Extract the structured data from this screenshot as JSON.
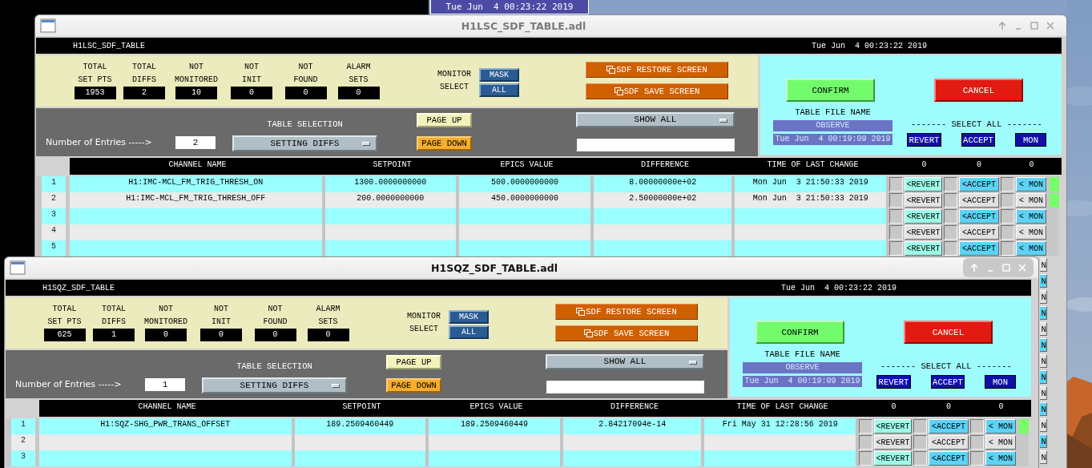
{
  "desktop": {
    "clock": "Tue Jun  4 00:23:22 2019"
  },
  "windows": [
    {
      "title": "H1LSC_SDF_TABLE.adl",
      "active": false,
      "screen_name": "H1LSC_SDF_TABLE",
      "time": "Tue Jun  4 00:23:22 2019",
      "stats": [
        {
          "label": [
            "TOTAL",
            "SET PTS"
          ],
          "value": "1953"
        },
        {
          "label": [
            "TOTAL",
            "DIFFS"
          ],
          "value": "2"
        },
        {
          "label": [
            "NOT",
            "MONITORED"
          ],
          "value": "10"
        },
        {
          "label": [
            "NOT",
            "INIT"
          ],
          "value": "0"
        },
        {
          "label": [
            "NOT",
            "FOUND"
          ],
          "value": "0"
        },
        {
          "label": [
            "ALARM",
            "SETS"
          ],
          "value": "0"
        }
      ],
      "monitor_select": {
        "label": [
          "MONITOR",
          "SELECT"
        ],
        "buttons": [
          "MASK",
          "ALL"
        ]
      },
      "screen_buttons": [
        "SDF RESTORE SCREEN",
        "SDF SAVE SCREEN"
      ],
      "entries": {
        "label": "Number of Entries ----->",
        "value": "2"
      },
      "table_selection": {
        "label": "TABLE SELECTION",
        "value": "SETTING DIFFS"
      },
      "page_buttons": [
        {
          "label": "PAGE UP",
          "kind": "up"
        },
        {
          "label": "PAGE DOWN",
          "kind": "down"
        }
      ],
      "filter": {
        "value": "SHOW ALL"
      },
      "confirm": "CONFIRM",
      "cancel": "CANCEL",
      "file": {
        "label": "TABLE FILE NAME",
        "name": "OBSERVE",
        "time": "Tue Jun  4 00:19:09 2019"
      },
      "select_all": {
        "label": "------- SELECT ALL -------",
        "buttons": [
          "REVERT",
          "ACCEPT",
          "MON"
        ]
      },
      "columns": [
        "CHANNEL NAME",
        "SETPOINT",
        "EPICS VALUE",
        "DIFFERENCE",
        "TIME OF LAST CHANGE",
        "0",
        "0",
        "0"
      ],
      "rows": [
        {
          "index": "1",
          "channel": "H1:IMC-MCL_FM_TRIG_THRESH_ON",
          "setpoint": "1300.0000000000",
          "epics": "500.0000000000",
          "difference": "8.00000000e+02",
          "time": "Mon Jun  3 21:50:33 2019",
          "buttons": [
            "<REVERT",
            "<ACCEPT",
            "< MON"
          ],
          "checks": [
            false,
            false,
            false
          ],
          "flagged": true
        },
        {
          "index": "2",
          "channel": "H1:IMC-MCL_FM_TRIG_THRESH_OFF",
          "setpoint": "200.0000000000",
          "epics": "450.0000000000",
          "difference": "2.50000000e+02",
          "time": "Mon Jun  3 21:50:33 2019",
          "buttons": [
            "<REVERT",
            "<ACCEPT",
            "< MON"
          ],
          "checks": [
            false,
            false,
            false
          ],
          "flagged": true
        },
        {
          "index": "3",
          "buttons": [
            "<REVERT",
            "<ACCEPT",
            "< MON"
          ],
          "checks": [
            false,
            false,
            false
          ],
          "flagged": false
        },
        {
          "index": "4",
          "buttons": [
            "<REVERT",
            "<ACCEPT",
            "< MON"
          ],
          "checks": [
            false,
            false,
            false
          ],
          "flagged": false
        },
        {
          "index": "5",
          "buttons": [
            "<REVERT",
            "<ACCEPT",
            "< MON"
          ],
          "checks": [
            false,
            false,
            false
          ],
          "flagged": false
        }
      ],
      "overflow_buttons": [
        "N",
        "N",
        "N",
        "N",
        "N",
        "N",
        "N",
        "N",
        "N",
        "N",
        "N",
        "N",
        "N"
      ]
    },
    {
      "title": "H1SQZ_SDF_TABLE.adl",
      "active": true,
      "screen_name": "H1SQZ_SDF_TABLE",
      "time": "Tue Jun  4 00:23:22 2019",
      "stats": [
        {
          "label": [
            "TOTAL",
            "SET PTS"
          ],
          "value": "625"
        },
        {
          "label": [
            "TOTAL",
            "DIFFS"
          ],
          "value": "1"
        },
        {
          "label": [
            "NOT",
            "MONITORED"
          ],
          "value": "0"
        },
        {
          "label": [
            "NOT",
            "INIT"
          ],
          "value": "0"
        },
        {
          "label": [
            "NOT",
            "FOUND"
          ],
          "value": "0"
        },
        {
          "label": [
            "ALARM",
            "SETS"
          ],
          "value": "0"
        }
      ],
      "monitor_select": {
        "label": [
          "MONITOR",
          "SELECT"
        ],
        "buttons": [
          "MASK",
          "ALL"
        ]
      },
      "screen_buttons": [
        "SDF RESTORE SCREEN",
        "SDF SAVE SCREEN"
      ],
      "entries": {
        "label": "Number of Entries ----->",
        "value": "1"
      },
      "table_selection": {
        "label": "TABLE SELECTION",
        "value": "SETTING DIFFS"
      },
      "page_buttons": [
        {
          "label": "PAGE UP",
          "kind": "up"
        },
        {
          "label": "PAGE DOWN",
          "kind": "down"
        }
      ],
      "filter": {
        "value": "SHOW ALL"
      },
      "confirm": "CONFIRM",
      "cancel": "CANCEL",
      "file": {
        "label": "TABLE FILE NAME",
        "name": "OBSERVE",
        "time": "Tue Jun  4 00:19:09 2019"
      },
      "select_all": {
        "label": "------- SELECT ALL -------",
        "buttons": [
          "REVERT",
          "ACCEPT",
          "MON"
        ]
      },
      "columns": [
        "CHANNEL NAME",
        "SETPOINT",
        "EPICS VALUE",
        "DIFFERENCE",
        "TIME OF LAST CHANGE",
        "0",
        "0",
        "0"
      ],
      "rows": [
        {
          "index": "1",
          "channel": "H1:SQZ-SHG_PWR_TRANS_OFFSET",
          "setpoint": "189.2509460449",
          "epics": "189.2509460449",
          "difference": "2.84217094e-14",
          "time": "Fri May 31 12:28:56 2019",
          "buttons": [
            "<REVERT",
            "<ACCEPT",
            "< MON"
          ],
          "checks": [
            false,
            false,
            false
          ],
          "flagged": true
        },
        {
          "index": "2",
          "buttons": [
            "<REVERT",
            "<ACCEPT",
            "< MON"
          ],
          "checks": [
            false,
            false,
            false
          ],
          "flagged": false
        },
        {
          "index": "3",
          "buttons": [
            "<REVERT",
            "<ACCEPT",
            "< MON"
          ],
          "checks": [
            false,
            false,
            false
          ],
          "flagged": false
        }
      ]
    }
  ]
}
